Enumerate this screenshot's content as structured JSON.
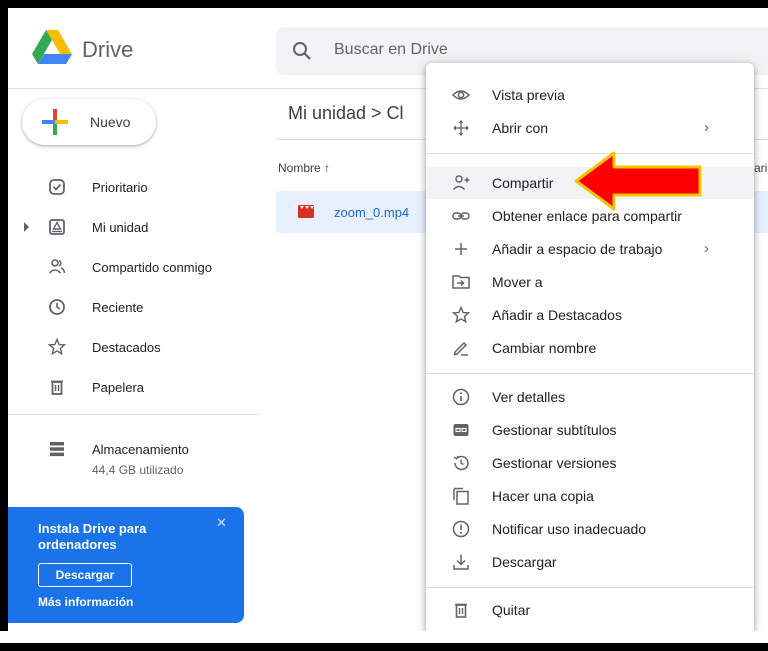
{
  "app": {
    "name": "Drive"
  },
  "search": {
    "placeholder": "Buscar en Drive"
  },
  "sidebar": {
    "new_label": "Nuevo",
    "items": [
      {
        "label": "Prioritario",
        "icon": "check-circle-icon"
      },
      {
        "label": "Mi unidad",
        "icon": "drive-icon"
      },
      {
        "label": "Compartido conmigo",
        "icon": "people-icon"
      },
      {
        "label": "Reciente",
        "icon": "clock-icon"
      },
      {
        "label": "Destacados",
        "icon": "star-icon"
      },
      {
        "label": "Papelera",
        "icon": "trash-icon"
      }
    ],
    "storage": {
      "label": "Almacenamiento",
      "used": "44,4 GB utilizado"
    }
  },
  "promo": {
    "title": "Instala Drive para ordenadores",
    "button": "Descargar",
    "link": "Más información",
    "close": "✕"
  },
  "main": {
    "breadcrumb": "Mi unidad  >  Cl",
    "column_name": "Nombre ↑",
    "column_cut": "ari",
    "file": {
      "name": "zoom_0.mp4"
    }
  },
  "context_menu": {
    "groups": [
      [
        {
          "label": "Vista previa",
          "icon": "eye-icon"
        },
        {
          "label": "Abrir con",
          "icon": "open-with-icon",
          "submenu": true
        }
      ],
      [
        {
          "label": "Compartir",
          "icon": "share-person-icon",
          "highlighted": true
        },
        {
          "label": "Obtener enlace para compartir",
          "icon": "link-icon"
        },
        {
          "label": "Añadir a espacio de trabajo",
          "icon": "plus-icon",
          "submenu": true
        },
        {
          "label": "Mover a",
          "icon": "move-folder-icon"
        },
        {
          "label": "Añadir a Destacados",
          "icon": "star-icon"
        },
        {
          "label": "Cambiar nombre",
          "icon": "pencil-icon"
        }
      ],
      [
        {
          "label": "Ver detalles",
          "icon": "info-icon"
        },
        {
          "label": "Gestionar subtítulos",
          "icon": "cc-icon"
        },
        {
          "label": "Gestionar versiones",
          "icon": "history-icon"
        },
        {
          "label": "Hacer una copia",
          "icon": "copy-icon"
        },
        {
          "label": "Notificar uso inadecuado",
          "icon": "report-icon"
        },
        {
          "label": "Descargar",
          "icon": "download-icon"
        }
      ],
      [
        {
          "label": "Quitar",
          "icon": "trash-icon"
        }
      ]
    ],
    "chevron": "›"
  },
  "colors": {
    "accent": "#1a73e8",
    "highlight_arrow": "#ff0000",
    "arrow_outline": "#f5c400"
  }
}
